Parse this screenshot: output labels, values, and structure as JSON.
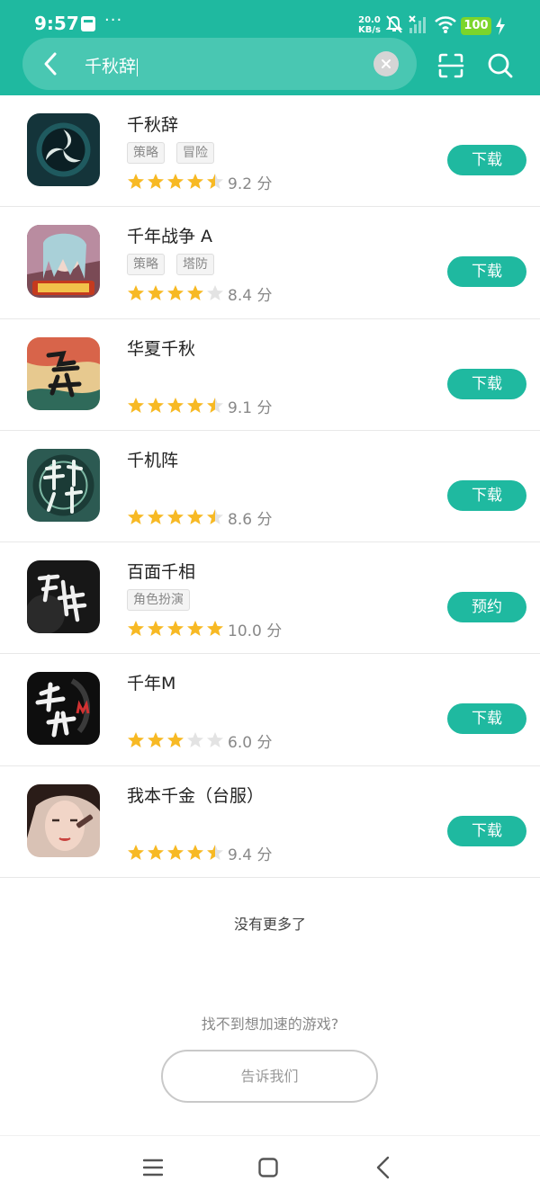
{
  "status_bar": {
    "time": "9:57",
    "network_speed_value": "20.0",
    "network_speed_unit": "KB/s",
    "battery": "100",
    "icons": [
      "notification-icon",
      "more-dots-icon",
      "mute-icon",
      "signal-icon",
      "wifi-icon",
      "battery-icon",
      "charging-icon"
    ]
  },
  "search": {
    "query": "千秋辞",
    "icons": [
      "back-icon",
      "clear-icon",
      "scan-icon",
      "search-icon"
    ]
  },
  "results": [
    {
      "name": "千秋辞",
      "tags": [
        "策略",
        "冒险"
      ],
      "rating": 4.5,
      "score": "9.2 分",
      "action": "下载"
    },
    {
      "name": "千年战争 A",
      "tags": [
        "策略",
        "塔防"
      ],
      "rating": 4,
      "score": "8.4 分",
      "action": "下载"
    },
    {
      "name": "华夏千秋",
      "tags": [],
      "rating": 4.5,
      "score": "9.1 分",
      "action": "下载"
    },
    {
      "name": "千机阵",
      "tags": [],
      "rating": 4.5,
      "score": "8.6 分",
      "action": "下载"
    },
    {
      "name": "百面千相",
      "tags": [
        "角色扮演"
      ],
      "rating": 5,
      "score": "10.0 分",
      "action": "预约"
    },
    {
      "name": "千年M",
      "tags": [],
      "rating": 3,
      "score": "6.0 分",
      "action": "下载"
    },
    {
      "name": "我本千金（台服）",
      "tags": [],
      "rating": 4.5,
      "score": "9.4 分",
      "action": "下载"
    }
  ],
  "footer": {
    "end_text": "没有更多了",
    "question": "找不到想加速的游戏?",
    "tell_button": "告诉我们"
  },
  "nav": {
    "icons": [
      "menu-icon",
      "home-icon",
      "back-nav-icon"
    ]
  },
  "colors": {
    "accent": "#1fb9a0",
    "star": "#f7b924",
    "star_empty": "#e3e3e3"
  }
}
